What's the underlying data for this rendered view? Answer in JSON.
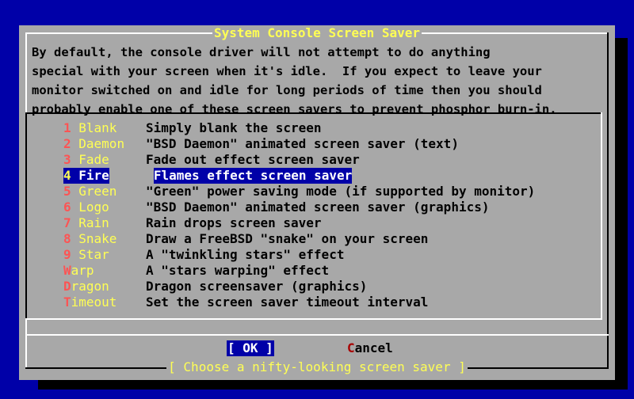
{
  "dialog": {
    "title": "System Console Screen Saver",
    "description": [
      "By default, the console driver will not attempt to do anything",
      "special with your screen when it's idle.  If you expect to leave your",
      "monitor switched on and idle for long periods of time then you should",
      "probably enable one of these screen savers to prevent phosphor burn-in."
    ],
    "items": [
      {
        "hot": "1",
        "rest": " Blank",
        "desc": "Simply blank the screen"
      },
      {
        "hot": "2",
        "rest": " Daemon",
        "desc": "\"BSD Daemon\" animated screen saver (text)"
      },
      {
        "hot": "3",
        "rest": " Fade",
        "desc": "Fade out effect screen saver"
      },
      {
        "hot": "4",
        "rest": " Fire",
        "desc": "Flames effect screen saver"
      },
      {
        "hot": "5",
        "rest": " Green",
        "desc": "\"Green\" power saving mode (if supported by monitor)"
      },
      {
        "hot": "6",
        "rest": " Logo",
        "desc": "\"BSD Daemon\" animated screen saver (graphics)"
      },
      {
        "hot": "7",
        "rest": " Rain",
        "desc": "Rain drops screen saver"
      },
      {
        "hot": "8",
        "rest": " Snake",
        "desc": "Draw a FreeBSD \"snake\" on your screen"
      },
      {
        "hot": "9",
        "rest": " Star",
        "desc": "A \"twinkling stars\" effect"
      },
      {
        "hot": "W",
        "rest": "arp",
        "desc": "A \"stars warping\" effect"
      },
      {
        "hot": "D",
        "rest": "ragon",
        "desc": "Dragon screensaver (graphics)"
      },
      {
        "hot": "T",
        "rest": "imeout",
        "desc": "Set the screen saver timeout interval"
      }
    ],
    "selected_index": 3,
    "ok_button": {
      "open": "[ ",
      "hot": "OK",
      "close": " ]"
    },
    "cancel_button": {
      "hot": "C",
      "rest": "ancel"
    },
    "prompt": "[ Choose a nifty-looking screen saver ]"
  },
  "colors": {
    "screen_bg": "#0000a8",
    "dialog_bg": "#a8a8a8",
    "title_fg": "#ffff54",
    "hotkey_fg": "#fc5454",
    "selected_bg": "#0000a8"
  }
}
